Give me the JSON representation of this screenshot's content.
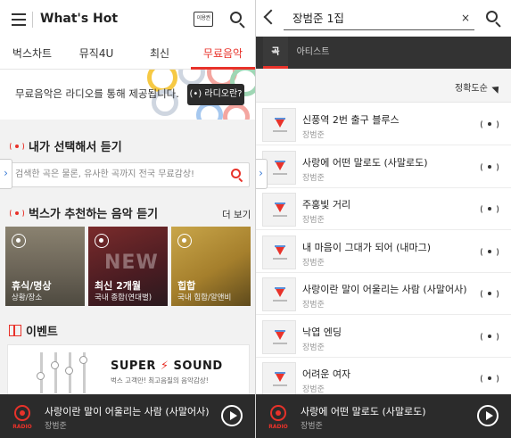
{
  "left": {
    "app_title": "What's Hot",
    "voucher_label": "이용권",
    "tabs": [
      {
        "label": "벅스차트"
      },
      {
        "label": "뮤직4U"
      },
      {
        "label": "최신"
      },
      {
        "label": "무료음악",
        "active": true
      }
    ],
    "banner": {
      "text": "무료음악은 라디오를 통해 제공됩니다.",
      "button_label": "(•) 라디오란?"
    },
    "section_pick": {
      "title": "내가 선택해서 듣기",
      "search_placeholder": "검색한 곡은 물론, 유사한 곡까지 전국 무료감상!"
    },
    "section_recommend": {
      "title": "벅스가 추천하는 음악 듣기",
      "more_label": "더 보기",
      "cards": [
        {
          "title": "휴식/명상",
          "sub": "상황/장소",
          "overlay": ""
        },
        {
          "title": "최신 2개월",
          "sub": "국내 종합(연대별)",
          "overlay": "NEW"
        },
        {
          "title": "힙합",
          "sub": "국내 힙합/알앤비",
          "overlay": ""
        }
      ]
    },
    "section_event": {
      "title": "이벤트",
      "banner_title_a": "SUPER",
      "banner_bolt": "⚡",
      "banner_title_b": "SOUND",
      "banner_sub": "벅스 고객만! 최고음질의 음악감상!"
    },
    "player": {
      "label": "RADIO",
      "title": "사랑이란 말이 어울리는 사람 (사말어사)",
      "artist": "장범준"
    }
  },
  "right": {
    "search_value": "장범준 1집",
    "clear_label": "×",
    "tabs": [
      {
        "label": "곡",
        "active": true
      },
      {
        "label": "아티스트"
      }
    ],
    "sort_label": "정확도순",
    "songs": [
      {
        "title": "신풍역 2번 출구 블루스",
        "artist": "장범준"
      },
      {
        "title": "사랑에 어떤 말로도 (사말로도)",
        "artist": "장범준"
      },
      {
        "title": "주홍빛 거리",
        "artist": "장범준"
      },
      {
        "title": "내 마음이 그대가 되어 (내마그)",
        "artist": "장범준"
      },
      {
        "title": "사랑이란 말이 어울리는 사람 (사말어사)",
        "artist": "장범준"
      },
      {
        "title": "낙엽 엔딩",
        "artist": "장범준"
      },
      {
        "title": "어려운 여자",
        "artist": "장범준"
      }
    ],
    "player": {
      "label": "RADIO",
      "title": "사랑에 어떤 말로도 (사말로도)",
      "artist": "장범준"
    }
  },
  "colors": {
    "accent": "#e8322a",
    "player_bg": "#2b2b2b",
    "tab_bar_bg": "#333333"
  },
  "icons": [
    "hamburger-icon",
    "search-icon",
    "back-icon",
    "clear-icon",
    "radio-icon",
    "play-icon",
    "gift-icon",
    "sort-triangle-icon"
  ]
}
